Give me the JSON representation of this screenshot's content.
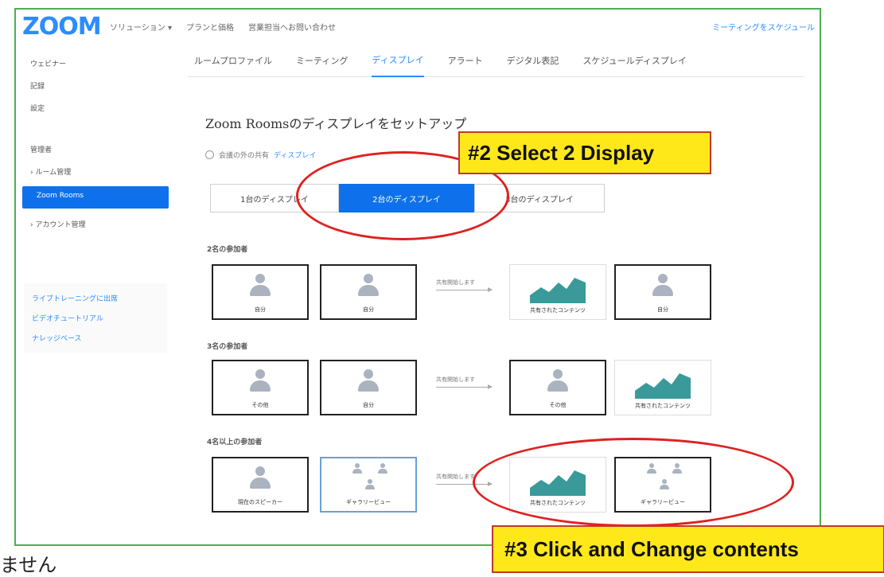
{
  "app": {
    "logo": "ZOOM"
  },
  "topbar": {
    "nav": [
      "ソリューション ▾",
      "プランと価格",
      "営業担当へお問い合わせ"
    ],
    "right_link": "ミーティングをスケジュール"
  },
  "sidebar": {
    "items": [
      "ウェビナー",
      "記録",
      "設定"
    ],
    "section": "管理者",
    "room_mgmt": "› ルーム管理",
    "active": "Zoom Rooms",
    "account": "› アカウント管理",
    "links": [
      "ライブトレーニングに出席",
      "ビデオチュートリアル",
      "ナレッジベース"
    ]
  },
  "tabs": [
    "ルームプロファイル",
    "ミーティング",
    "ディスプレイ",
    "アラート",
    "デジタル表記",
    "スケジュールディスプレイ"
  ],
  "main": {
    "heading": "Zoom Roomsのディスプレイをセットアップ",
    "radio_text": "会議の外の共有",
    "radio_link": "ディスプレイ",
    "segments": [
      "1台のディスプレイ",
      "2台のディスプレイ",
      "3台のディスプレイ"
    ],
    "sections": [
      "2名の参加者",
      "3名の参加者",
      "4名以上の参加者"
    ],
    "arrow_label": "共有開始します",
    "captions": {
      "you": "自分",
      "shared": "共有されたコンテンツ",
      "other": "その他",
      "speaker": "現在のスピーカー",
      "gallery": "ギャラリービュー"
    }
  },
  "annotations": {
    "select": "#2  Select 2 Display",
    "change": "#3  Click and Change contents"
  },
  "partial_text": "ません"
}
